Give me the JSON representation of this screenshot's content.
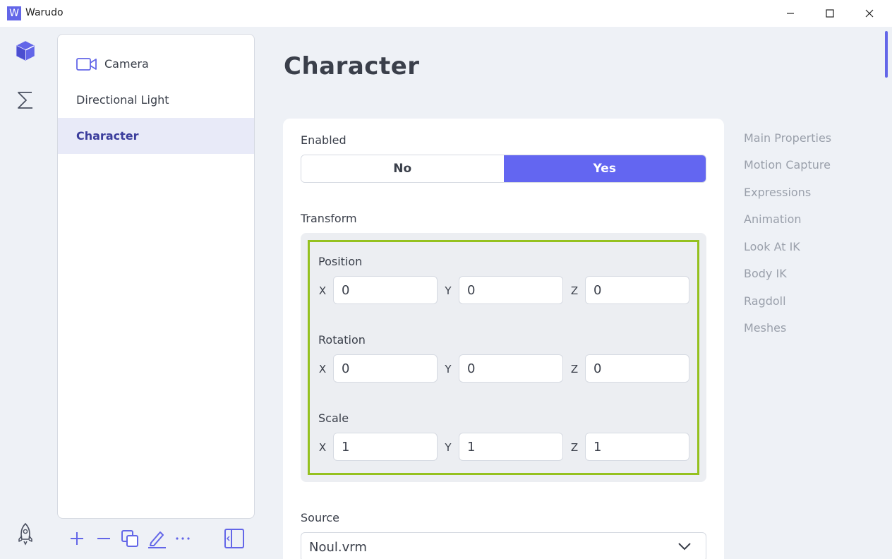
{
  "window": {
    "app_logo_letter": "W",
    "title": "Warudo",
    "minimize_icon": "minimize-icon",
    "maximize_icon": "maximize-icon",
    "close_icon": "close-icon"
  },
  "rail": {
    "icons": [
      "cube-icon",
      "sigma-icon",
      "rocket-icon"
    ]
  },
  "tree": {
    "items": [
      {
        "label": "Camera",
        "icon": "video-camera-icon"
      },
      {
        "label": "Directional Light"
      },
      {
        "label": "Character",
        "selected": true
      }
    ]
  },
  "toolbar": {
    "icons": [
      "plus-icon",
      "minus-icon",
      "duplicate-icon",
      "edit-icon",
      "more-icon",
      "collapse-panel-icon"
    ]
  },
  "page": {
    "title": "Character"
  },
  "enabled": {
    "label": "Enabled",
    "options": [
      "No",
      "Yes"
    ],
    "selected": "Yes"
  },
  "transform": {
    "label": "Transform",
    "position": {
      "label": "Position",
      "x": "0",
      "y": "0",
      "z": "0"
    },
    "rotation": {
      "label": "Rotation",
      "x": "0",
      "y": "0",
      "z": "0"
    },
    "scale": {
      "label": "Scale",
      "x": "1",
      "y": "1",
      "z": "1"
    },
    "axis_labels": {
      "x": "X",
      "y": "Y",
      "z": "Z"
    }
  },
  "source": {
    "label": "Source",
    "value": "Noul.vrm"
  },
  "sections_nav": {
    "items": [
      "Main Properties",
      "Motion Capture",
      "Expressions",
      "Animation",
      "Look At IK",
      "Body IK",
      "Ragdoll",
      "Meshes"
    ]
  },
  "colors": {
    "accent": "#6366f1",
    "highlight_border": "#95c11f",
    "selected_bg": "#e8eaf8"
  }
}
